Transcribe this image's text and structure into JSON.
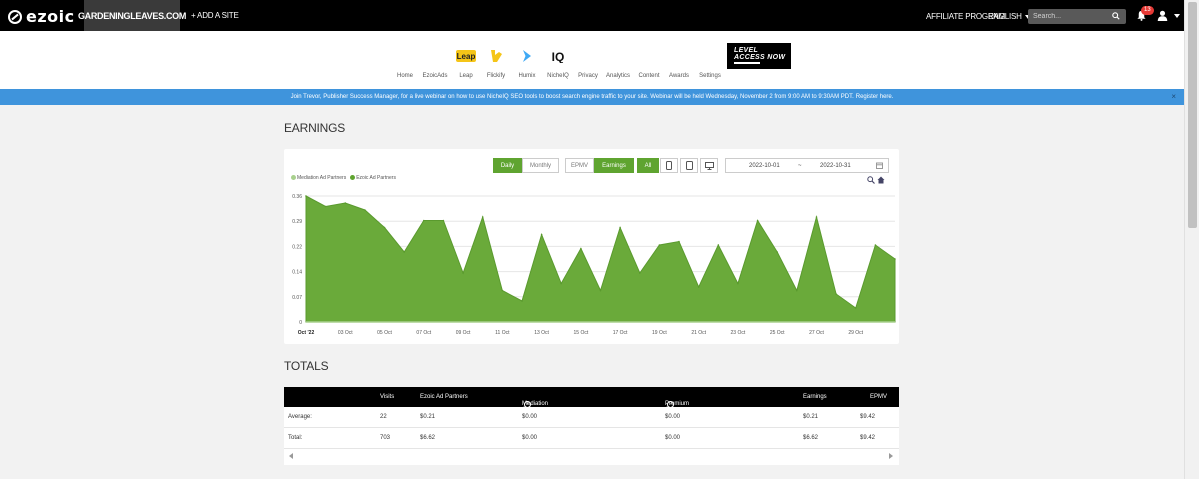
{
  "brand": {
    "logo_text": "ezoic",
    "accent": "#5fa430",
    "nav_bg": "#000000",
    "banner_bg": "#3f94dc"
  },
  "topnav": {
    "site_name": "GARDENINGLEAVES.COM",
    "add_site": "+ ADD A SITE",
    "affiliate": "AFFILIATE PROGRAM",
    "language": "ENGLISH",
    "search_placeholder": "Search...",
    "notification_count": "13"
  },
  "apps": [
    {
      "label": "Home",
      "icon": "home-icon",
      "color": "#5fa430"
    },
    {
      "label": "EzoicAds",
      "icon": "ezoicads-icon",
      "color": "#5fa430"
    },
    {
      "label": "Leap",
      "icon": "leap-icon",
      "color": "#3d3d3d"
    },
    {
      "label": "Flickify",
      "icon": "flickify-icon",
      "color": "#2d3e50"
    },
    {
      "label": "Humix",
      "icon": "humix-icon",
      "color": "#111111"
    },
    {
      "label": "NicheIQ",
      "icon": "nicheiq-icon",
      "color": "#22cc66"
    },
    {
      "label": "Privacy",
      "icon": "shield-icon",
      "color": "#5fa430"
    },
    {
      "label": "Analytics",
      "icon": "analytics-icon",
      "color": "#5fa430"
    },
    {
      "label": "Content",
      "icon": "content-icon",
      "color": "#5fa430"
    },
    {
      "label": "Awards",
      "icon": "trophy-icon",
      "color": "#5fa430"
    },
    {
      "label": "Settings",
      "icon": "gear-icon",
      "color": "#5fa430"
    }
  ],
  "level_access": {
    "line1": "LEVEL",
    "line2": "ACCESS NOW"
  },
  "announcement": {
    "text": "Join Trevor, Publisher Success Manager, for a live webinar on how to use NicheIQ SEO tools to boost search engine traffic to your site. Webinar will be held Wednesday, November 2 from 9:00 AM to 9:30AM PDT.",
    "link": "Register here.",
    "close": "×"
  },
  "earnings": {
    "title": "EARNINGS",
    "controls": {
      "daily": "Daily",
      "monthly": "Monthly",
      "epmv": "EPMV",
      "earnings": "Earnings",
      "all": "All"
    },
    "date_from": "2022-10-01",
    "date_sep": "~",
    "date_to": "2022-10-31",
    "legend": [
      {
        "name": "Mediation Ad Partners",
        "color": "#a8d08d"
      },
      {
        "name": "Ezoic Ad Partners",
        "color": "#5fa430"
      }
    ]
  },
  "chart_data": {
    "type": "area",
    "series": [
      {
        "name": "Ezoic Ad Partners",
        "values": [
          0.36,
          0.33,
          0.34,
          0.32,
          0.27,
          0.2,
          0.29,
          0.29,
          0.14,
          0.3,
          0.09,
          0.06,
          0.25,
          0.11,
          0.21,
          0.09,
          0.27,
          0.14,
          0.22,
          0.23,
          0.1,
          0.22,
          0.11,
          0.29,
          0.2,
          0.09,
          0.3,
          0.08,
          0.04,
          0.22,
          0.18
        ]
      },
      {
        "name": "Mediation Ad Partners",
        "values": [
          0,
          0,
          0,
          0,
          0,
          0,
          0,
          0,
          0,
          0,
          0,
          0,
          0,
          0,
          0,
          0,
          0,
          0,
          0,
          0,
          0,
          0,
          0,
          0,
          0,
          0,
          0,
          0,
          0,
          0,
          0
        ]
      }
    ],
    "x_tick_labels": [
      "Oct '22",
      "03 Oct",
      "05 Oct",
      "07 Oct",
      "09 Oct",
      "11 Oct",
      "13 Oct",
      "15 Oct",
      "17 Oct",
      "19 Oct",
      "21 Oct",
      "23 Oct",
      "25 Oct",
      "27 Oct",
      "29 Oct"
    ],
    "y_tick_labels": [
      "0",
      "0.07",
      "0.14",
      "0.22",
      "0.29",
      "0.36"
    ],
    "ylim": [
      0,
      0.36
    ],
    "grid": true,
    "legend_position": "top-left"
  },
  "totals": {
    "title": "TOTALS",
    "headers": [
      "",
      "Visits",
      "Ezoic Ad Partners",
      "Mediation Ad Partners",
      "Premium Ad Partners",
      "Earnings",
      "EPMV"
    ],
    "rows": [
      {
        "label": "Average:",
        "cells": [
          "22",
          "$0.21",
          "$0.00",
          "$0.00",
          "$0.21",
          "$9.42"
        ]
      },
      {
        "label": "Total:",
        "cells": [
          "703",
          "$6.62",
          "$0.00",
          "$0.00",
          "$6.62",
          "$9.42"
        ]
      }
    ]
  }
}
